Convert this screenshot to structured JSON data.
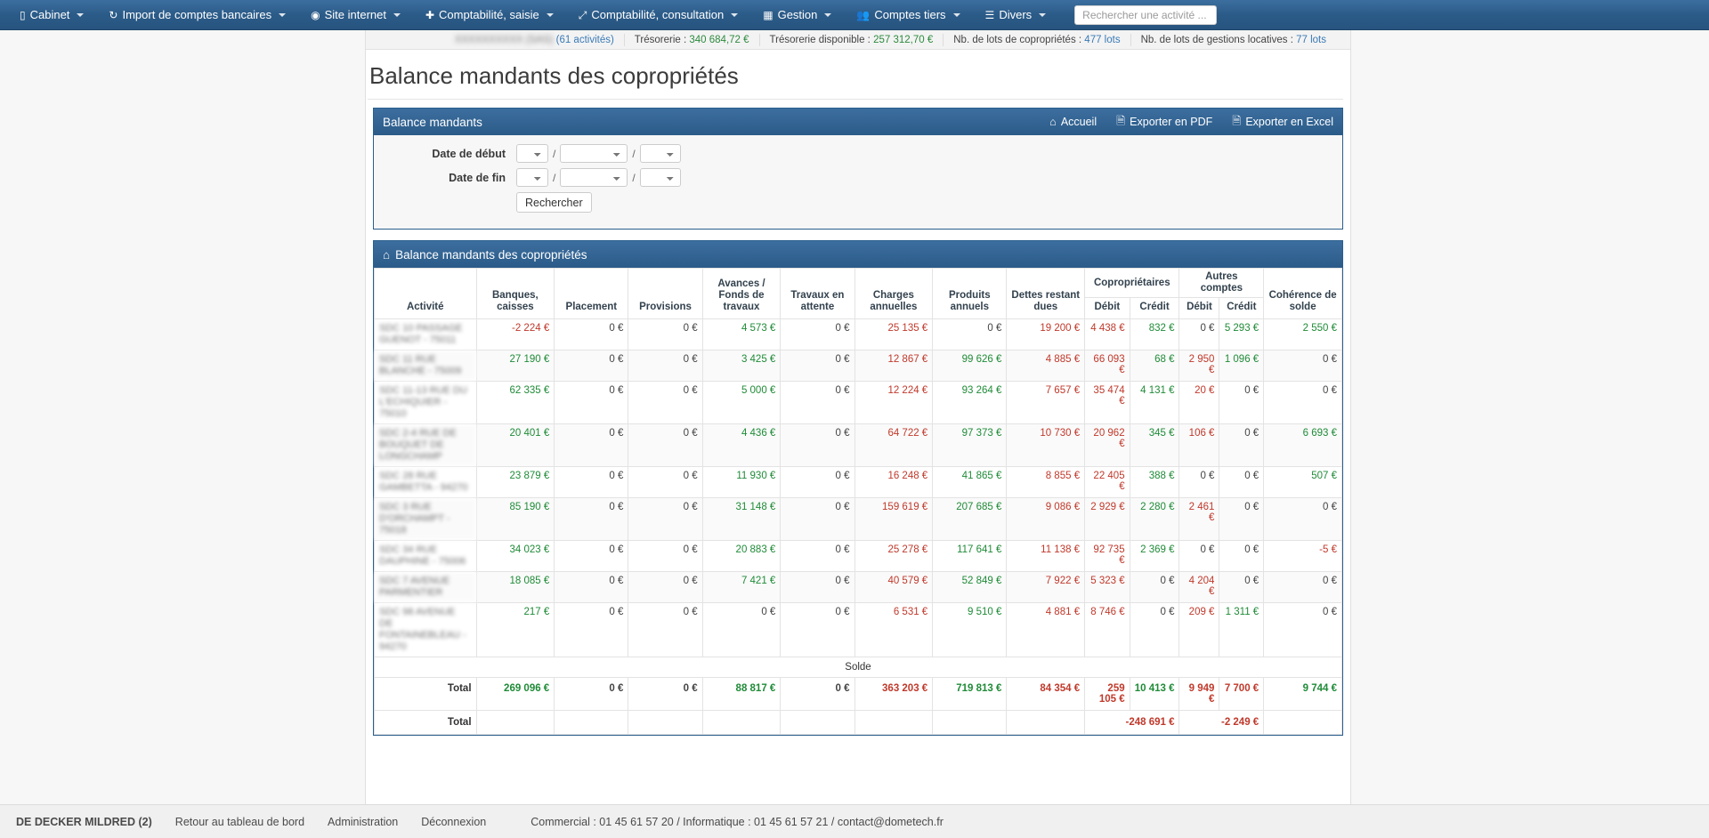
{
  "navbar": {
    "items": [
      {
        "icon": "building-icon",
        "glyph": "▯",
        "label": "Cabinet",
        "caret": true
      },
      {
        "icon": "refresh-icon",
        "glyph": "↻",
        "label": "Import de comptes bancaires",
        "caret": true
      },
      {
        "icon": "location-pin-icon",
        "glyph": "◉",
        "label": "Site internet",
        "caret": true
      },
      {
        "icon": "plus-icon",
        "glyph": "✚",
        "label": "Comptabilité, saisie",
        "caret": true
      },
      {
        "icon": "chart-line-icon",
        "glyph": "📈",
        "label": "Comptabilité, consultation",
        "caret": true
      },
      {
        "icon": "calendar-icon",
        "glyph": "▦",
        "label": "Gestion",
        "caret": true
      },
      {
        "icon": "users-icon",
        "glyph": "👥",
        "label": "Comptes tiers",
        "caret": true
      },
      {
        "icon": "bars-icon",
        "glyph": "☰",
        "label": "Divers",
        "caret": true
      }
    ],
    "search": {
      "placeholder": "Rechercher une activité ...",
      "value": ""
    }
  },
  "statsbar": {
    "company": {
      "name_masked": "XXXXXXXXXX (SAS)",
      "activities": "(61 activités)"
    },
    "items": [
      {
        "label": "Trésorerie :",
        "value": "340 684,72 €",
        "color": "green"
      },
      {
        "label": "Trésorerie disponible :",
        "value": "257 312,70 €",
        "color": "green"
      },
      {
        "label": "Nb. de lots de copropriétés :",
        "value": "477 lots",
        "color": "blue"
      },
      {
        "label": "Nb. de lots de gestions locatives :",
        "value": "77 lots",
        "color": "blue"
      }
    ]
  },
  "page": {
    "title": "Balance mandants des copropriétés"
  },
  "panel": {
    "title": "Balance mandants",
    "actions": [
      {
        "name": "home",
        "glyph": "⌂",
        "label": "Accueil"
      },
      {
        "name": "export-pdf",
        "glyph": "🗎",
        "label": "Exporter en PDF"
      },
      {
        "name": "export-excel",
        "glyph": "🗎",
        "label": "Exporter en Excel"
      }
    ],
    "form": {
      "date_debut_label": "Date de début",
      "date_fin_label": "Date de fin",
      "separator": "/",
      "day_value": "",
      "month_value": "",
      "year_value": "",
      "search_button": "Rechercher"
    }
  },
  "table_panel": {
    "title": "Balance mandants des copropriétés",
    "icon": "home-icon"
  },
  "chart_data": {
    "type": "table",
    "title": "Balance mandants des copropriétés",
    "group_headers": [
      {
        "label": "Copropriétaires",
        "span": 2
      },
      {
        "label": "Autres comptes",
        "span": 2
      }
    ],
    "columns": [
      "Activité",
      "Banques, caisses",
      "Placement",
      "Provisions",
      "Avances / Fonds de travaux",
      "Travaux en attente",
      "Charges annuelles",
      "Produits annuels",
      "Dettes restant dues",
      "Débit",
      "Crédit",
      "Débit",
      "Crédit",
      "Cohérence de solde"
    ],
    "rows": [
      {
        "activite": "SDC 10 PASSAGE GUENOT - 75011",
        "values": [
          "-2 224 €",
          "0 €",
          "0 €",
          "4 573 €",
          "0 €",
          "25 135 €",
          "0 €",
          "19 200 €",
          "4 438 €",
          "832 €",
          "0 €",
          "5 293 €",
          "2 550 €"
        ],
        "signs": [
          "neg",
          "zero",
          "zero",
          "pos",
          "zero",
          "neg",
          "zero",
          "neg",
          "neg",
          "pos",
          "zero",
          "pos",
          "pos"
        ]
      },
      {
        "activite": "SDC 11 RUE BLANCHE - 75009",
        "values": [
          "27 190 €",
          "0 €",
          "0 €",
          "3 425 €",
          "0 €",
          "12 867 €",
          "99 626 €",
          "4 885 €",
          "66 093 €",
          "68 €",
          "2 950 €",
          "1 096 €",
          "0 €"
        ],
        "signs": [
          "pos",
          "zero",
          "zero",
          "pos",
          "zero",
          "neg",
          "pos",
          "neg",
          "neg",
          "pos",
          "neg",
          "pos",
          "zero"
        ]
      },
      {
        "activite": "SDC 11-13 RUE DU L'ECHIQUIER - 75010",
        "values": [
          "62 335 €",
          "0 €",
          "0 €",
          "5 000 €",
          "0 €",
          "12 224 €",
          "93 264 €",
          "7 657 €",
          "35 474 €",
          "4 131 €",
          "20 €",
          "0 €",
          "0 €"
        ],
        "signs": [
          "pos",
          "zero",
          "zero",
          "pos",
          "zero",
          "neg",
          "pos",
          "neg",
          "neg",
          "pos",
          "neg",
          "zero",
          "zero"
        ]
      },
      {
        "activite": "SDC 2-4 RUE DE BOUQUET DE LONGCHAMP",
        "values": [
          "20 401 €",
          "0 €",
          "0 €",
          "4 436 €",
          "0 €",
          "64 722 €",
          "97 373 €",
          "10 730 €",
          "20 962 €",
          "345 €",
          "106 €",
          "0 €",
          "6 693 €"
        ],
        "signs": [
          "pos",
          "zero",
          "zero",
          "pos",
          "zero",
          "neg",
          "pos",
          "neg",
          "neg",
          "pos",
          "neg",
          "zero",
          "pos"
        ]
      },
      {
        "activite": "SDC 28 RUE GAMBETTA - 94270",
        "values": [
          "23 879 €",
          "0 €",
          "0 €",
          "11 930 €",
          "0 €",
          "16 248 €",
          "41 865 €",
          "8 855 €",
          "22 405 €",
          "388 €",
          "0 €",
          "0 €",
          "507 €"
        ],
        "signs": [
          "pos",
          "zero",
          "zero",
          "pos",
          "zero",
          "neg",
          "pos",
          "neg",
          "neg",
          "pos",
          "zero",
          "zero",
          "pos"
        ]
      },
      {
        "activite": "SDC 3 RUE D'ORCHAMPT - 75018",
        "values": [
          "85 190 €",
          "0 €",
          "0 €",
          "31 148 €",
          "0 €",
          "159 619 €",
          "207 685 €",
          "9 086 €",
          "2 929 €",
          "2 280 €",
          "2 461 €",
          "0 €",
          "0 €"
        ],
        "signs": [
          "pos",
          "zero",
          "zero",
          "pos",
          "zero",
          "neg",
          "pos",
          "neg",
          "neg",
          "pos",
          "neg",
          "zero",
          "zero"
        ]
      },
      {
        "activite": "SDC 34 RUE DAUPHINE - 75006",
        "values": [
          "34 023 €",
          "0 €",
          "0 €",
          "20 883 €",
          "0 €",
          "25 278 €",
          "117 641 €",
          "11 138 €",
          "92 735 €",
          "2 369 €",
          "0 €",
          "0 €",
          "-5 €"
        ],
        "signs": [
          "pos",
          "zero",
          "zero",
          "pos",
          "zero",
          "neg",
          "pos",
          "neg",
          "neg",
          "pos",
          "zero",
          "zero",
          "neg"
        ]
      },
      {
        "activite": "SDC 7 AVENUE PARMENTIER",
        "values": [
          "18 085 €",
          "0 €",
          "0 €",
          "7 421 €",
          "0 €",
          "40 579 €",
          "52 849 €",
          "7 922 €",
          "5 323 €",
          "0 €",
          "4 204 €",
          "0 €",
          "0 €"
        ],
        "signs": [
          "pos",
          "zero",
          "zero",
          "pos",
          "zero",
          "neg",
          "pos",
          "neg",
          "neg",
          "zero",
          "neg",
          "zero",
          "zero"
        ]
      },
      {
        "activite": "SDC 98 AVENUE DE FONTAINEBLEAU - 94270",
        "values": [
          "217 €",
          "0 €",
          "0 €",
          "0 €",
          "0 €",
          "6 531 €",
          "9 510 €",
          "4 881 €",
          "8 746 €",
          "0 €",
          "209 €",
          "1 311 €",
          "0 €"
        ],
        "signs": [
          "pos",
          "zero",
          "zero",
          "zero",
          "zero",
          "neg",
          "pos",
          "neg",
          "neg",
          "zero",
          "neg",
          "pos",
          "zero"
        ]
      }
    ],
    "solde_label": "Solde",
    "total_label": "Total",
    "totals": {
      "label": "Total",
      "values": [
        "269 096 €",
        "0 €",
        "0 €",
        "88 817 €",
        "0 €",
        "363 203 €",
        "719 813 €",
        "84 354 €",
        "259 105 €",
        "10 413 €",
        "9 949 €",
        "7 700 €",
        "9 744 €"
      ],
      "signs": [
        "pos",
        "zero",
        "zero",
        "pos",
        "zero",
        "neg",
        "pos",
        "neg",
        "neg",
        "pos",
        "neg",
        "neg",
        "pos"
      ]
    },
    "totals2": {
      "label": "Total",
      "coproprietaires": "-248 691 €",
      "autres_comptes": "-2 249 €",
      "signs": [
        "neg",
        "neg"
      ]
    }
  },
  "footer": {
    "user": "DE DECKER MILDRED (2)",
    "links": [
      "Retour au tableau de bord",
      "Administration",
      "Déconnexion"
    ],
    "contact": "Commercial : 01 45 61 57 20 / Informatique : 01 45 61 57 21 / contact@dometech.fr"
  }
}
